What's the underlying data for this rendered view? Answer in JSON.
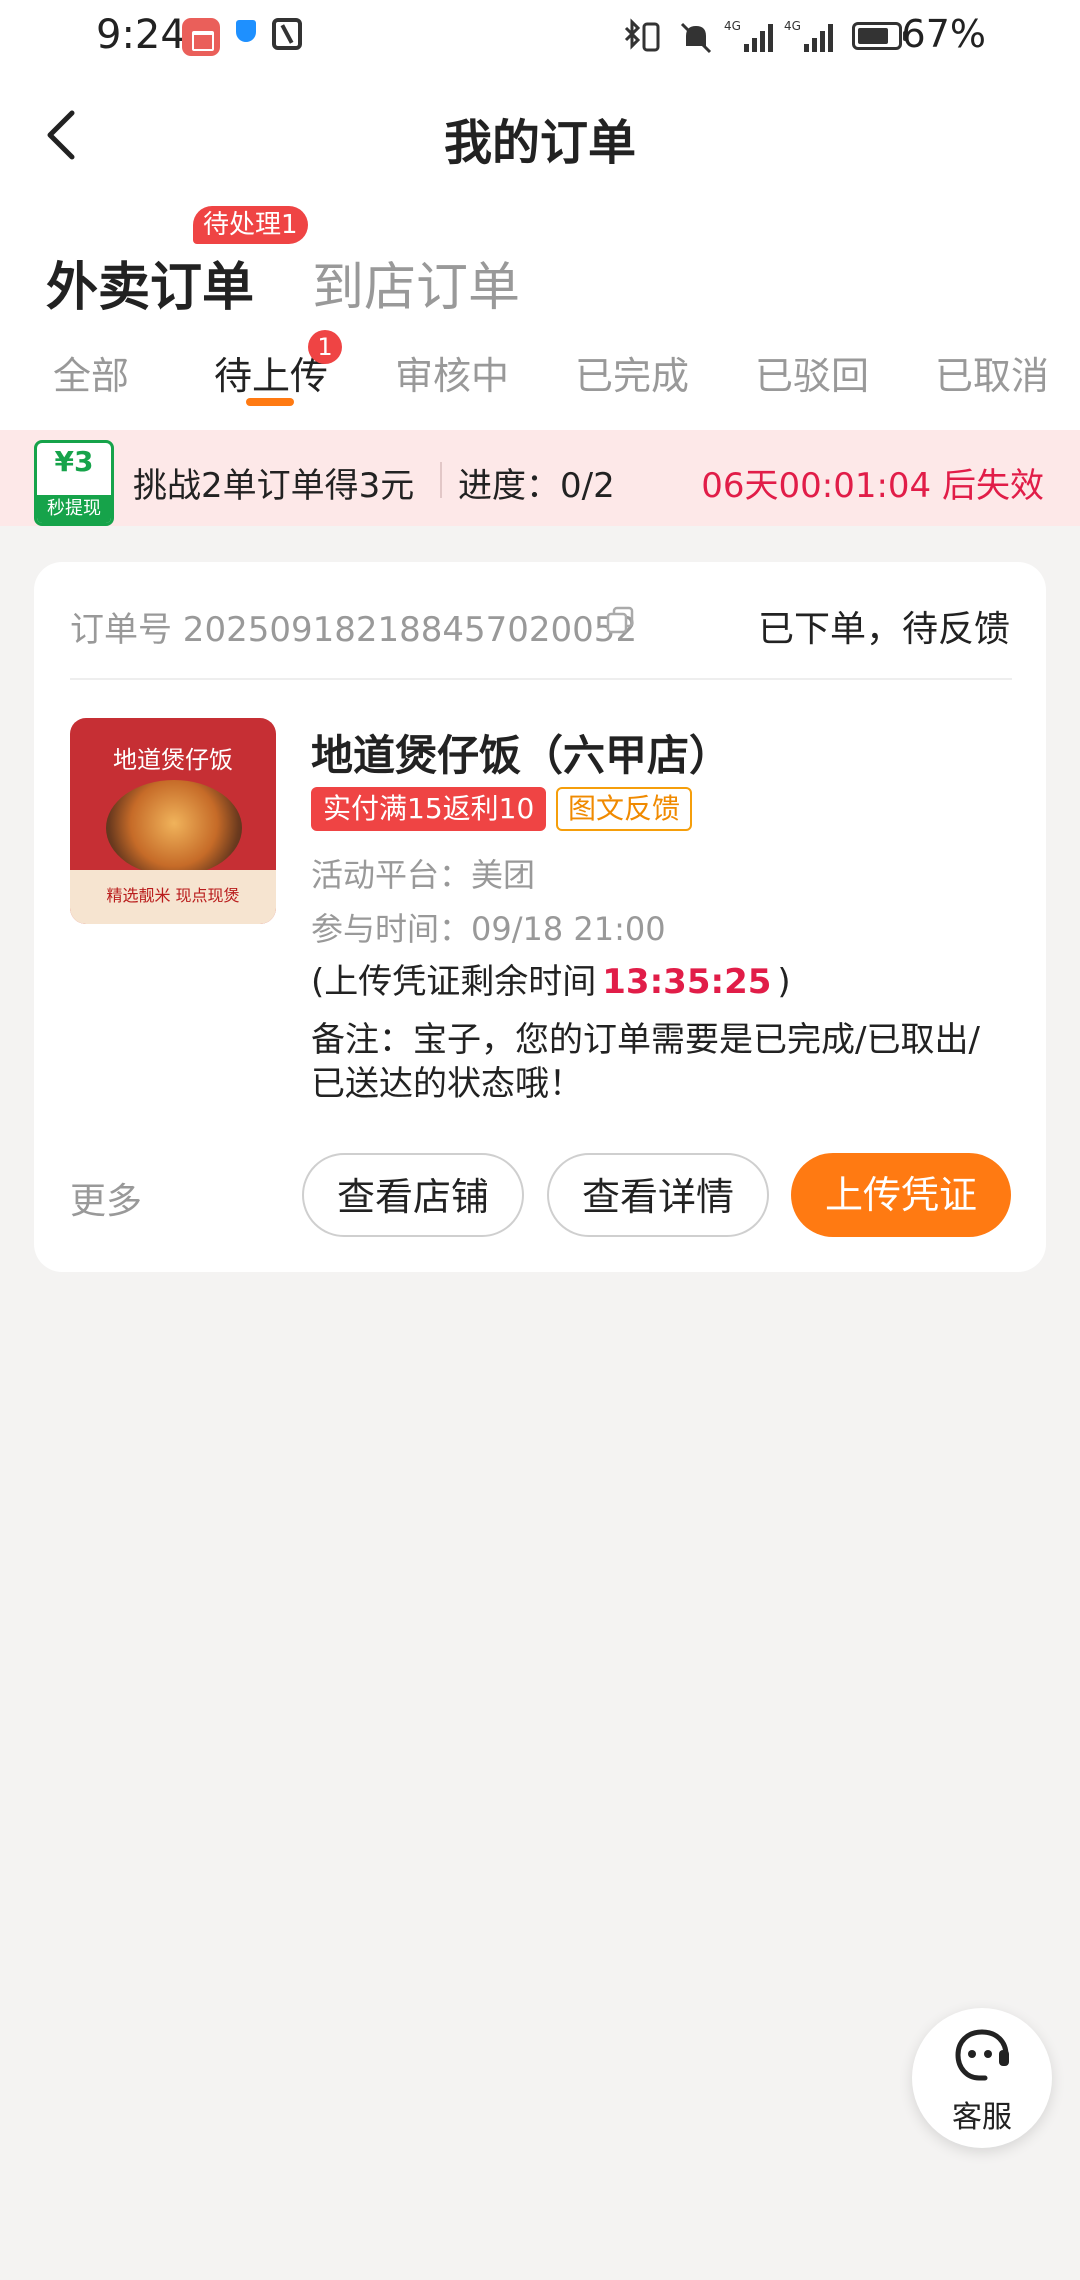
{
  "status_bar": {
    "time": "9:24",
    "battery": "67%"
  },
  "header": {
    "title": "我的订单"
  },
  "top_tabs": {
    "active": "外卖订单",
    "inactive": "到店订单",
    "pending_badge": "待处理1"
  },
  "status_tabs": [
    "全部",
    "待上传",
    "审核中",
    "已完成",
    "已驳回",
    "已取消"
  ],
  "status_tab_count": "1",
  "challenge": {
    "reward_amount": "¥3",
    "reward_tag": "秒提现",
    "text": "挑战2单订单得3元",
    "progress": "进度：0/2",
    "timer": "06天00:01:04 后失效"
  },
  "order": {
    "order_no": "订单号 20250918218845702005​2",
    "status": "已下单，待反馈",
    "store_image_title": "地道煲仔饭",
    "store_image_footer": "精选靓米  现点现煲",
    "store_name": "地道煲仔饭（六甲店）",
    "tag_rebate": "实付满15返利10",
    "tag_feedback": "图文反馈",
    "platform": "活动平台：美团",
    "join_time": "参与时间：09/18 21:00",
    "countdown_prefix": "(上传凭证剩余时间",
    "countdown_time": "13:35:25",
    "countdown_suffix": ")",
    "remark": "备注：宝子，您的订单需要是已完成/已取出/已送达的状态哦！",
    "more": "更多",
    "btn_view_store": "查看店铺",
    "btn_view_detail": "查看详情",
    "btn_upload": "上传凭证"
  },
  "customer_service": {
    "label": "客服"
  },
  "colors": {
    "accent": "#ff7a12",
    "alert": "#ef4444",
    "success": "#16a34a"
  }
}
